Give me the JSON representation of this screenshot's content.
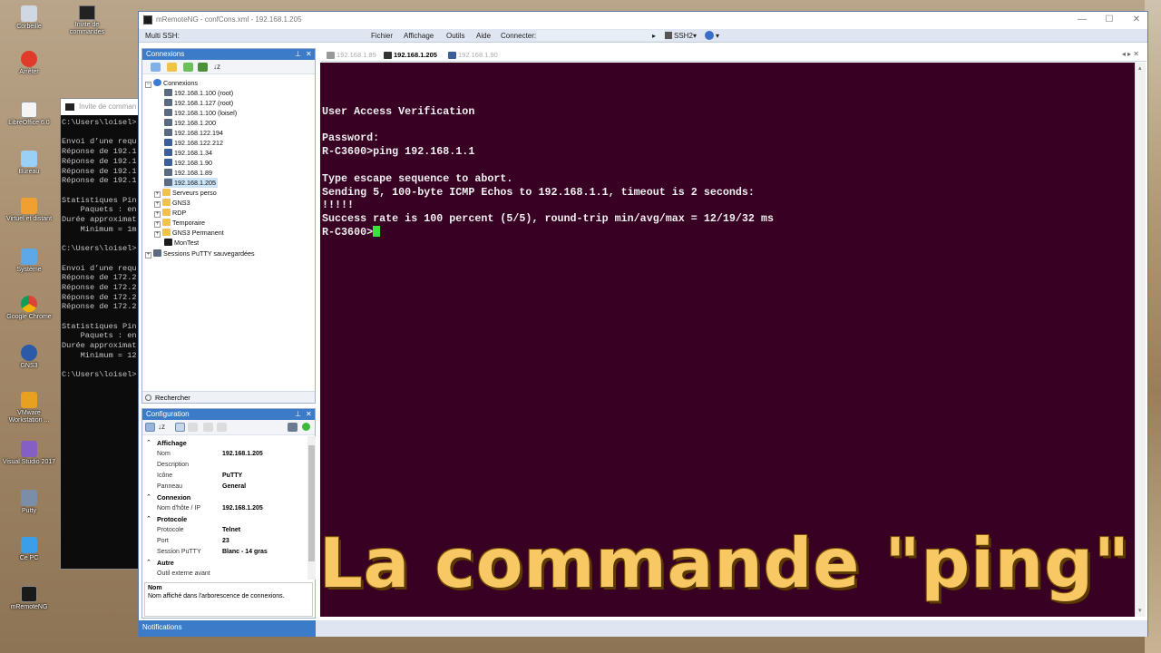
{
  "desktop": {
    "icons": [
      {
        "label": "Corbeille",
        "icon": "recycle-bin-icon"
      },
      {
        "label": "Arrêter",
        "icon": "power-icon"
      },
      {
        "label": "LibreOffice 6.0",
        "icon": "document-icon"
      },
      {
        "label": "Bureau",
        "icon": "desktop-icon"
      },
      {
        "label": "Virtuel et distant",
        "icon": "folder-icon"
      },
      {
        "label": "Système",
        "icon": "system-icon"
      },
      {
        "label": "Google Chrome",
        "icon": "chrome-icon"
      },
      {
        "label": "GNS3",
        "icon": "gns3-icon"
      },
      {
        "label": "VMware Workstation ...",
        "icon": "vmware-icon"
      },
      {
        "label": "Visual Studio 2017",
        "icon": "visual-studio-icon"
      },
      {
        "label": "Putty",
        "icon": "putty-icon"
      },
      {
        "label": "Ce PC",
        "icon": "computer-icon"
      },
      {
        "label": "mRemoteNG",
        "icon": "mremoteng-icon"
      }
    ],
    "cmd_shortcut": "Invite de commandes"
  },
  "cmd_window": {
    "title": "Invite de comman",
    "lines": [
      "C:\\Users\\loisel>",
      "",
      "Envoi d’une requ",
      "Réponse de 192.1",
      "Réponse de 192.1",
      "Réponse de 192.1",
      "Réponse de 192.1",
      "",
      "Statistiques Pin",
      "    Paquets : en",
      "Durée approximat",
      "    Minimum = 1m",
      "",
      "C:\\Users\\loisel>",
      "",
      "Envoi d’une requ",
      "Réponse de 172.2",
      "Réponse de 172.2",
      "Réponse de 172.2",
      "Réponse de 172.2",
      "",
      "Statistiques Pin",
      "    Paquets : en",
      "Durée approximat",
      "    Minimum = 12",
      "",
      "C:\\Users\\loisel>"
    ]
  },
  "window": {
    "title": "mRemoteNG - confCons.xml - 192.168.1.205",
    "controls": {
      "minimize": "—",
      "maximize": "☐",
      "close": "✕"
    }
  },
  "menubar": {
    "multi_ssh": "Multi SSH:",
    "items": [
      "Fichier",
      "Affichage",
      "Outils",
      "Aide"
    ],
    "connect_label": "Connecter:",
    "protocol": "SSH2"
  },
  "connections_panel": {
    "title": "Connexions",
    "root": "Connexions",
    "nodes": [
      {
        "label": "192.168.1.100 (root)",
        "type": "putty"
      },
      {
        "label": "192.168.1.127 (root)",
        "type": "putty"
      },
      {
        "label": "192.168.1.100 (loisel)",
        "type": "putty"
      },
      {
        "label": "192.168.1.200",
        "type": "putty"
      },
      {
        "label": "192.168.122.194",
        "type": "putty"
      },
      {
        "label": "192.168.122.212",
        "type": "rdp"
      },
      {
        "label": "192.168.1.34",
        "type": "rdp"
      },
      {
        "label": "192.168.1.90",
        "type": "rdp"
      },
      {
        "label": "192.168.1.89",
        "type": "putty"
      },
      {
        "label": "192.168.1.205",
        "type": "putty",
        "selected": true
      }
    ],
    "folders": [
      "Serveurs perso",
      "GNS3",
      "RDP",
      "Temporaire",
      "GNS3 Permanent"
    ],
    "montest": "MonTest",
    "saved_sessions": "Sessions PuTTY sauvegardées",
    "search": "Rechercher"
  },
  "config_panel": {
    "title": "Configuration",
    "categories": [
      {
        "name": "Affichage",
        "props": [
          {
            "key": "Nom",
            "value": "192.168.1.205"
          },
          {
            "key": "Description",
            "value": ""
          },
          {
            "key": "Icône",
            "value": "PuTTY"
          },
          {
            "key": "Panneau",
            "value": "General"
          }
        ]
      },
      {
        "name": "Connexion",
        "props": [
          {
            "key": "Nom d'hôte / IP",
            "value": "192.168.1.205"
          }
        ]
      },
      {
        "name": "Protocole",
        "props": [
          {
            "key": "Protocole",
            "value": "Telnet"
          },
          {
            "key": "Port",
            "value": "23"
          },
          {
            "key": "Session PuTTY",
            "value": "Blanc - 14 gras"
          }
        ]
      },
      {
        "name": "Autre",
        "props": [
          {
            "key": "Outil externe avant",
            "value": ""
          }
        ]
      }
    ],
    "desc_title": "Nom",
    "desc_text": "Nom affiché dans l'arborescence de connexions."
  },
  "notifications": "Notifications",
  "tabs": [
    {
      "label": "192.168.1.89",
      "active": false
    },
    {
      "label": "192.168.1.205",
      "active": true
    },
    {
      "label": "192.168.1.90",
      "active": false
    }
  ],
  "terminal": {
    "lines": [
      "",
      "User Access Verification",
      "",
      "Password:",
      "R-C3600>ping 192.168.1.1",
      "",
      "Type escape sequence to abort.",
      "Sending 5, 100-byte ICMP Echos to 192.168.1.1, timeout is 2 seconds:",
      "!!!!!",
      "Success rate is 100 percent (5/5), round-trip min/avg/max = 12/19/32 ms"
    ],
    "prompt": "R-C3600>",
    "bg_color": "#380023",
    "cursor_color": "#39e23a"
  },
  "caption": "La commande \"ping\""
}
